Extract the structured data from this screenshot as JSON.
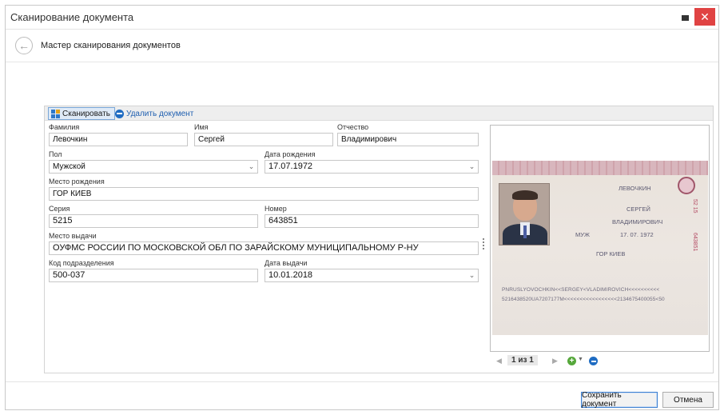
{
  "window": {
    "title": "Сканирование документа"
  },
  "wizard": {
    "title": "Мастер сканирования документов",
    "back_icon": "arrow-left-circle-icon"
  },
  "toolbar": {
    "scan_label": "Сканировать",
    "delete_label": "Удалить документ"
  },
  "form": {
    "surname": {
      "label": "Фамилия",
      "value": "Левочкин"
    },
    "name": {
      "label": "Имя",
      "value": "Сергей"
    },
    "patronymic": {
      "label": "Отчество",
      "value": "Владимирович"
    },
    "sex": {
      "label": "Пол",
      "value": "Мужской"
    },
    "birth_date": {
      "label": "Дата рождения",
      "value": "17.07.1972"
    },
    "birth_place": {
      "label": "Место рождения",
      "value": "ГОР КИЕВ"
    },
    "series": {
      "label": "Серия",
      "value": "5215"
    },
    "number": {
      "label": "Номер",
      "value": "643851"
    },
    "issued_by": {
      "label": "Место выдачи",
      "value": "ОУФМС РОССИИ ПО МОСКОВСКОЙ ОБЛ ПО ЗАРАЙСКОМУ МУНИЦИПАЛЬНОМУ Р-НУ"
    },
    "division_code": {
      "label": "Код подразделения",
      "value": "500-037"
    },
    "issue_date": {
      "label": "Дата выдачи",
      "value": "10.01.2018"
    }
  },
  "passport_image": {
    "surname": "ЛЕВОЧКИН",
    "name": "СЕРГЕЙ",
    "patronymic": "ВЛАДИМИРОВИЧ",
    "sex": "МУЖ",
    "birth_date": "17. 07. 1972",
    "birth_place": "ГОР КИЕВ",
    "side_series": "52 15",
    "side_number": "643851",
    "mrz_line1": "PNRUSLYOVOCHKIN<<SERGEY<VLADIMIROVICH<<<<<<<<<<",
    "mrz_line2": "5216438520UA7207177M<<<<<<<<<<<<<<<<<2134675400055<50"
  },
  "pager": {
    "text": "1 из 1"
  },
  "buttons": {
    "save": "Сохранить документ",
    "cancel": "Отмена"
  }
}
